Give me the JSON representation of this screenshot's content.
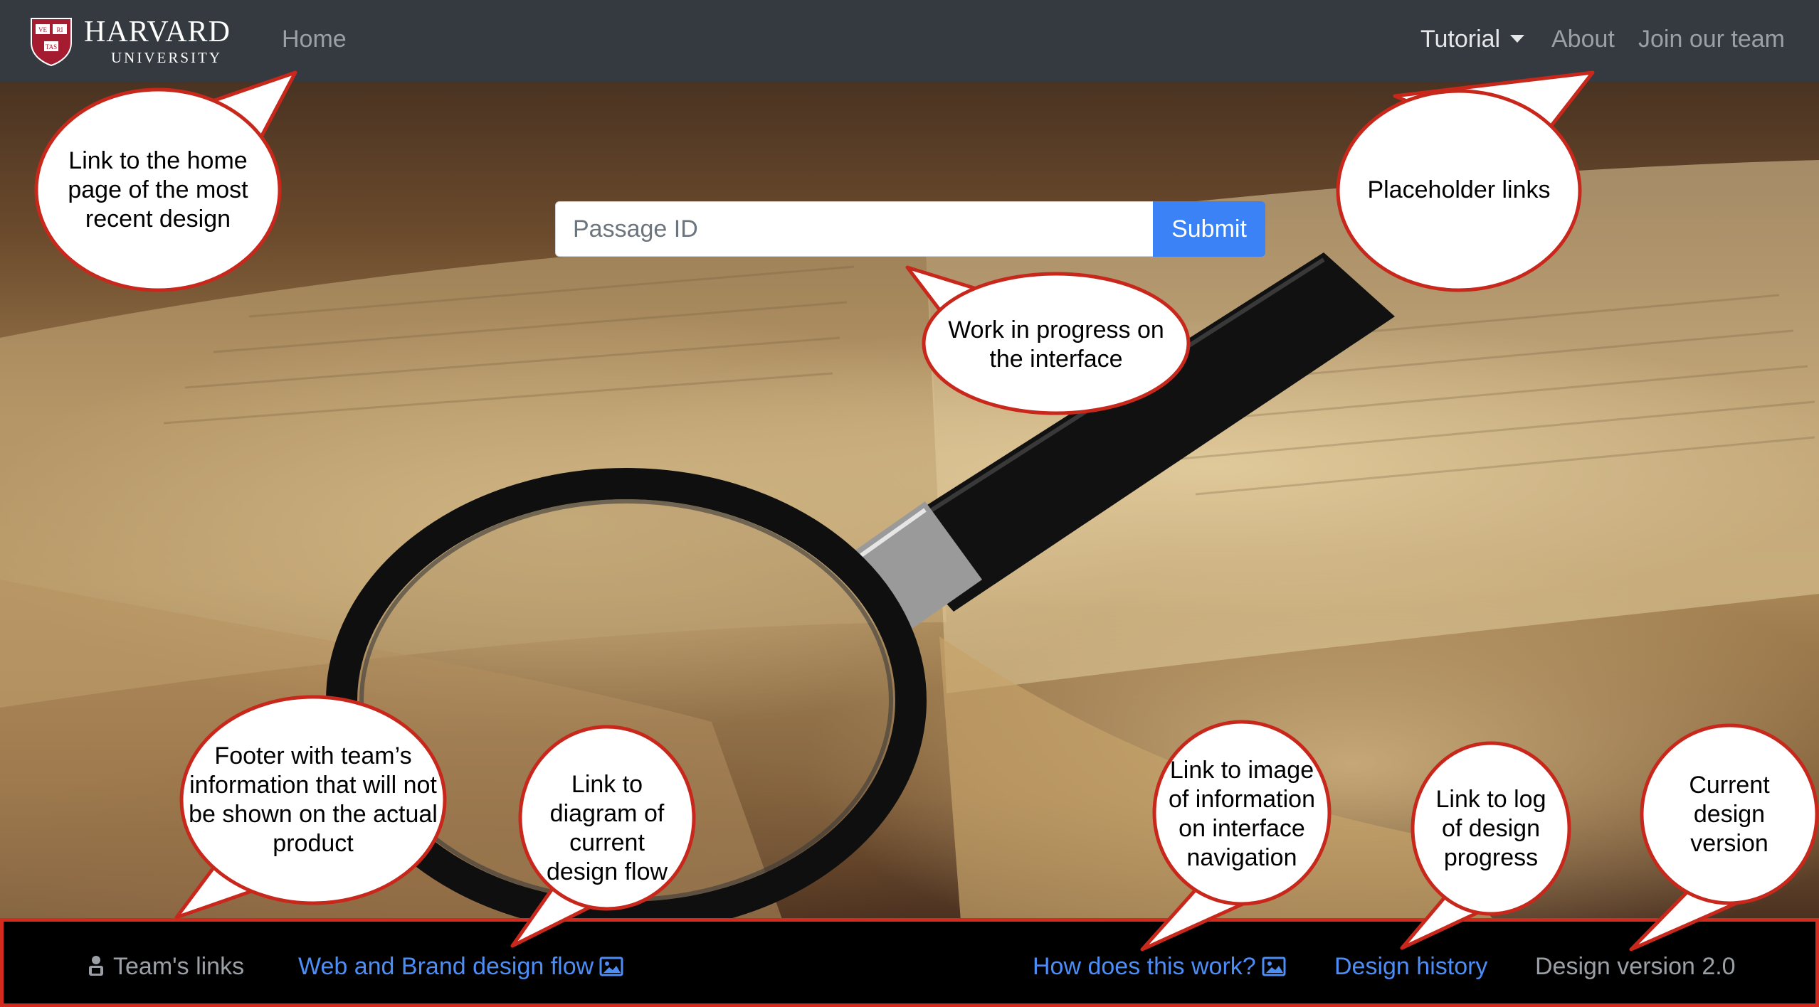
{
  "navbar": {
    "brand_name": "HARVARD",
    "brand_sub": "UNIVERSITY",
    "shield_text": [
      "VE",
      "RI",
      "TAS"
    ],
    "home": "Home",
    "tutorial": "Tutorial",
    "about": "About",
    "join": "Join our team"
  },
  "search": {
    "placeholder": "Passage ID",
    "value": "",
    "submit": "Submit"
  },
  "footer": {
    "team_links": "Team's links",
    "web_brand": "Web and Brand design flow",
    "how_works": "How does this work?",
    "design_history": "Design history",
    "design_version": "Design version 2.0"
  },
  "callouts": {
    "home": "Link to the home page of the most recent design",
    "placeholder": "Placeholder links",
    "wip": "Work in progress on the interface",
    "footer_info": "Footer with team’s information that will not be shown on the actual product",
    "diagram": "Link to diagram of current design flow",
    "image_info": "Link to image of information on interface navigation",
    "log": "Link to log of design progress",
    "version": "Current design version"
  },
  "colors": {
    "navbar_bg": "#343a40",
    "accent_blue": "#3b82f6",
    "link_blue": "#4c8df6",
    "highlight_red": "#d42b1e",
    "footer_bg": "#000000"
  },
  "icons": {
    "shield": "harvard-shield-icon",
    "team": "developer-icon",
    "image": "image-icon",
    "caret": "caret-down-icon"
  }
}
